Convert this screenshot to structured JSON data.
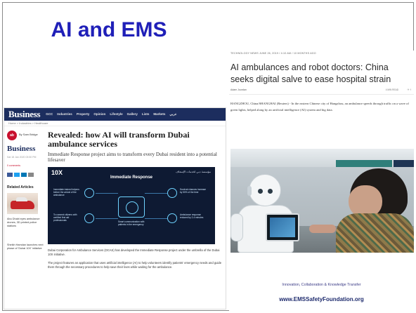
{
  "slide": {
    "title": "AI and EMS"
  },
  "left_article": {
    "site_brand": "Business",
    "nav": [
      "GCC",
      "Industries",
      "Property",
      "Opinion",
      "Lifestyle",
      "Gallery",
      "Lists",
      "Markets",
      "عربي"
    ],
    "breadcrumb": "Home > Industries > Healthcare",
    "logo_text": "ab",
    "byline": "By Sam Bridge",
    "side_brand": "Business",
    "date": "Sat 18 Jan 2020 03:50 PM",
    "comments": "0 comments",
    "related_heading": "Related Articles",
    "related": [
      "Abu Dhabi eyes ambulance drones, 3D printed police stations",
      "Sheikh Hamdan launches next phase of 'Dubai 10X' initiative"
    ],
    "title": "Revealed: how AI will transform Dubai ambulance services",
    "dek": "Immediate Response project aims to transform every Dubai resident into a potential lifesaver",
    "infographic": {
      "logo": "10X",
      "brand": "مؤسسة دبي لخدمات الإسعاف",
      "title": "Immediate Response",
      "captions": [
        "Immediate trained helpers before the arrival of the ambulance",
        "Survival chances increase by 50% of the time",
        "To connect citizens with certified first aid professionals",
        "Smart communication with patients in the emergency",
        "Ambulance response reduced by 2-4 minutes"
      ]
    },
    "body": [
      "Dubai Corporation for Ambulance Services (DCAS) has developed the Immediate Response project under the umbrella of the Dubai 10X initiative.",
      "The project features an application that uses artificial intelligence (AI) to help volunteers identify patients' emergency needs and guide them through the necessary procedures to help save their lives while waiting for the ambulance."
    ]
  },
  "right_article": {
    "section": "TECHNOLOGY NEWS   JUNE 26, 2019 / 4:10 AM / 10 MONTHS AGO",
    "title": "AI ambulances and robot doctors: China seeks digital salve to ease hospital strain",
    "author": "Adam Jourdan",
    "read_time": "4 MIN READ",
    "body": "HANGZHOU, China/SHANGHAI (Reuters) - In the eastern Chinese city of Hangzhou, an ambulance speeds through traffic on a wave of green lights, helped along by an artificial intelligence (AI) system and big data."
  },
  "footer": {
    "tagline": "Innovation, Collaboration & Knowledge Transfer",
    "url": "www.EMSSafetyFoundation.org"
  }
}
